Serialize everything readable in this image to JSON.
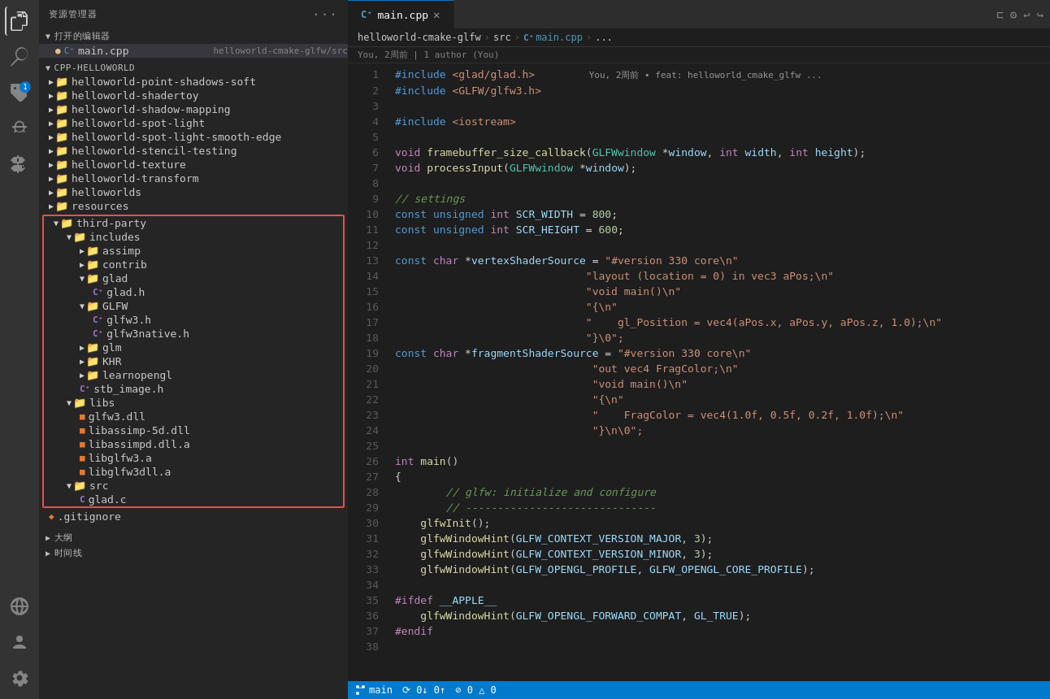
{
  "activityBar": {
    "icons": [
      {
        "name": "files-icon",
        "symbol": "⬡",
        "active": true
      },
      {
        "name": "search-icon",
        "symbol": "🔍",
        "active": false
      },
      {
        "name": "git-icon",
        "symbol": "⎇",
        "active": false
      },
      {
        "name": "debug-icon",
        "symbol": "▷",
        "active": false
      },
      {
        "name": "extensions-icon",
        "symbol": "⊞",
        "active": false
      },
      {
        "name": "remote-icon",
        "symbol": "◈",
        "active": false
      }
    ],
    "bottomIcons": [
      {
        "name": "accounts-icon",
        "symbol": "👤"
      },
      {
        "name": "settings-icon",
        "symbol": "⚙"
      }
    ],
    "notificationCount": "1"
  },
  "sidebar": {
    "header": "资源管理器",
    "openEditors": {
      "label": "打开的编辑器",
      "files": [
        {
          "name": "main.cpp",
          "path": "helloworld-cmake-glfw/src",
          "active": true,
          "modified": true,
          "icon": "cpp"
        }
      ]
    },
    "project": {
      "name": "CPP-HELLOWORLD",
      "items": [
        {
          "label": "helloworld-point-shadows-soft",
          "indent": 1,
          "type": "folder"
        },
        {
          "label": "helloworld-shadertoy",
          "indent": 1,
          "type": "folder"
        },
        {
          "label": "helloworld-shadow-mapping",
          "indent": 1,
          "type": "folder"
        },
        {
          "label": "helloworld-spot-light",
          "indent": 1,
          "type": "folder"
        },
        {
          "label": "helloworld-spot-light-smooth-edge",
          "indent": 1,
          "type": "folder"
        },
        {
          "label": "helloworld-stencil-testing",
          "indent": 1,
          "type": "folder"
        },
        {
          "label": "helloworld-texture",
          "indent": 1,
          "type": "folder"
        },
        {
          "label": "helloworld-transform",
          "indent": 1,
          "type": "folder"
        },
        {
          "label": "helloworlds",
          "indent": 1,
          "type": "folder"
        },
        {
          "label": "resources",
          "indent": 1,
          "type": "folder"
        },
        {
          "label": "third-party",
          "indent": 1,
          "type": "folder",
          "expanded": true,
          "highlighted": true
        },
        {
          "label": "includes",
          "indent": 2,
          "type": "folder",
          "expanded": true
        },
        {
          "label": "assimp",
          "indent": 3,
          "type": "folder"
        },
        {
          "label": "contrib",
          "indent": 3,
          "type": "folder"
        },
        {
          "label": "glad",
          "indent": 3,
          "type": "folder",
          "expanded": true
        },
        {
          "label": "glad.h",
          "indent": 4,
          "type": "h-file"
        },
        {
          "label": "GLFW",
          "indent": 3,
          "type": "folder",
          "expanded": true
        },
        {
          "label": "glfw3.h",
          "indent": 4,
          "type": "h-file"
        },
        {
          "label": "glfw3native.h",
          "indent": 4,
          "type": "h-file"
        },
        {
          "label": "glm",
          "indent": 3,
          "type": "folder"
        },
        {
          "label": "KHR",
          "indent": 3,
          "type": "folder"
        },
        {
          "label": "learnopengl",
          "indent": 3,
          "type": "folder"
        },
        {
          "label": "stb_image.h",
          "indent": 3,
          "type": "h-file"
        },
        {
          "label": "libs",
          "indent": 2,
          "type": "folder",
          "expanded": true
        },
        {
          "label": "glfw3.dll",
          "indent": 3,
          "type": "dll-file"
        },
        {
          "label": "libassimp-5d.dll",
          "indent": 3,
          "type": "dll-file"
        },
        {
          "label": "libassimpd.dll.a",
          "indent": 3,
          "type": "dll-file"
        },
        {
          "label": "libglfw3.a",
          "indent": 3,
          "type": "dll-file"
        },
        {
          "label": "libglfw3dll.a",
          "indent": 3,
          "type": "dll-file"
        },
        {
          "label": "src",
          "indent": 2,
          "type": "folder",
          "expanded": true
        },
        {
          "label": "glad.c",
          "indent": 3,
          "type": "c-file"
        },
        {
          "label": ".gitignore",
          "indent": 1,
          "type": "git-file"
        }
      ]
    }
  },
  "editor": {
    "tab": {
      "filename": "main.cpp",
      "modified": false,
      "icon": "cpp"
    },
    "breadcrumb": {
      "parts": [
        "helloworld-cmake-glfw",
        "src",
        "main.cpp",
        "..."
      ]
    },
    "gitBlame": "You, 2周前 | 1 author (You)",
    "gitInline": "You, 2周前 • feat: helloworld_cmake_glfw ...",
    "lines": [
      {
        "num": 1,
        "tokens": [
          {
            "t": "preprocessor",
            "v": "#include"
          },
          {
            "t": "space",
            "v": " "
          },
          {
            "t": "include-path",
            "v": "<glad/glad.h>"
          }
        ]
      },
      {
        "num": 2,
        "tokens": [
          {
            "t": "preprocessor",
            "v": "#include"
          },
          {
            "t": "space",
            "v": " "
          },
          {
            "t": "include-path",
            "v": "<GLFW/glfw3.h>"
          }
        ]
      },
      {
        "num": 3,
        "tokens": []
      },
      {
        "num": 4,
        "tokens": [
          {
            "t": "preprocessor",
            "v": "#include"
          },
          {
            "t": "space",
            "v": " "
          },
          {
            "t": "include-path",
            "v": "<iostream>"
          }
        ]
      },
      {
        "num": 5,
        "tokens": []
      },
      {
        "num": 6,
        "tokens": [
          {
            "t": "void",
            "v": "void"
          },
          {
            "t": "space",
            "v": " "
          },
          {
            "t": "fn",
            "v": "framebuffer_size_callback"
          },
          {
            "t": "plain",
            "v": "("
          },
          {
            "t": "type",
            "v": "GLFWwindow"
          },
          {
            "t": "space",
            "v": " "
          },
          {
            "t": "ptr",
            "v": "*"
          },
          {
            "t": "param",
            "v": "window"
          },
          {
            "t": "plain",
            "v": ", "
          },
          {
            "t": "int",
            "v": "int"
          },
          {
            "t": "space",
            "v": " "
          },
          {
            "t": "param",
            "v": "width"
          },
          {
            "t": "plain",
            "v": ", "
          },
          {
            "t": "int",
            "v": "int"
          },
          {
            "t": "space",
            "v": " "
          },
          {
            "t": "param",
            "v": "height"
          },
          {
            "t": "plain",
            "v": ");"
          }
        ]
      },
      {
        "num": 7,
        "tokens": [
          {
            "t": "void",
            "v": "void"
          },
          {
            "t": "space",
            "v": " "
          },
          {
            "t": "fn",
            "v": "processInput"
          },
          {
            "t": "plain",
            "v": "("
          },
          {
            "t": "type",
            "v": "GLFWwindow"
          },
          {
            "t": "space",
            "v": " "
          },
          {
            "t": "ptr",
            "v": "*"
          },
          {
            "t": "param",
            "v": "window"
          },
          {
            "t": "plain",
            "v": ");"
          }
        ]
      },
      {
        "num": 8,
        "tokens": []
      },
      {
        "num": 9,
        "tokens": [
          {
            "t": "comment",
            "v": "// settings"
          }
        ]
      },
      {
        "num": 10,
        "tokens": [
          {
            "t": "kw",
            "v": "const"
          },
          {
            "t": "space",
            "v": " "
          },
          {
            "t": "unsigned",
            "v": "unsigned"
          },
          {
            "t": "space",
            "v": " "
          },
          {
            "t": "int",
            "v": "int"
          },
          {
            "t": "space",
            "v": " "
          },
          {
            "t": "macro",
            "v": "SCR_WIDTH"
          },
          {
            "t": "plain",
            "v": " = "
          },
          {
            "t": "num",
            "v": "800"
          },
          {
            "t": "plain",
            "v": ";"
          }
        ]
      },
      {
        "num": 11,
        "tokens": [
          {
            "t": "kw",
            "v": "const"
          },
          {
            "t": "space",
            "v": " "
          },
          {
            "t": "unsigned",
            "v": "unsigned"
          },
          {
            "t": "space",
            "v": " "
          },
          {
            "t": "int",
            "v": "int"
          },
          {
            "t": "space",
            "v": " "
          },
          {
            "t": "macro",
            "v": "SCR_HEIGHT"
          },
          {
            "t": "plain",
            "v": " = "
          },
          {
            "t": "num",
            "v": "600"
          },
          {
            "t": "plain",
            "v": ";"
          }
        ]
      },
      {
        "num": 12,
        "tokens": []
      },
      {
        "num": 13,
        "tokens": [
          {
            "t": "kw",
            "v": "const"
          },
          {
            "t": "space",
            "v": " "
          },
          {
            "t": "char",
            "v": "char"
          },
          {
            "t": "space",
            "v": " "
          },
          {
            "t": "ptr",
            "v": "*"
          },
          {
            "t": "macro",
            "v": "vertexShaderSource"
          },
          {
            "t": "plain",
            "v": " = "
          },
          {
            "t": "str",
            "v": "\"#version 330 core\\n\""
          }
        ]
      },
      {
        "num": 14,
        "tokens": [
          {
            "t": "str",
            "v": "                              \"layout (location = 0) in vec3 aPos;\\n\""
          }
        ]
      },
      {
        "num": 15,
        "tokens": [
          {
            "t": "str",
            "v": "                              \"void main()\\n\""
          }
        ]
      },
      {
        "num": 16,
        "tokens": [
          {
            "t": "str",
            "v": "                              \"{\\n\""
          }
        ]
      },
      {
        "num": 17,
        "tokens": [
          {
            "t": "str",
            "v": "                              \"    gl_Position = vec4(aPos.x, aPos.y, aPos.z, 1.0);\\n\""
          }
        ]
      },
      {
        "num": 18,
        "tokens": [
          {
            "t": "str",
            "v": "                              \"}\\0\";"
          }
        ]
      },
      {
        "num": 19,
        "tokens": [
          {
            "t": "kw",
            "v": "const"
          },
          {
            "t": "space",
            "v": " "
          },
          {
            "t": "char",
            "v": "char"
          },
          {
            "t": "space",
            "v": " "
          },
          {
            "t": "ptr",
            "v": "*"
          },
          {
            "t": "macro",
            "v": "fragmentShaderSource"
          },
          {
            "t": "plain",
            "v": " = "
          },
          {
            "t": "str",
            "v": "\"#version 330 core\\n\""
          }
        ]
      },
      {
        "num": 20,
        "tokens": [
          {
            "t": "str",
            "v": "                               \"out vec4 FragColor;\\n\""
          }
        ]
      },
      {
        "num": 21,
        "tokens": [
          {
            "t": "str",
            "v": "                               \"void main()\\n\""
          }
        ]
      },
      {
        "num": 22,
        "tokens": [
          {
            "t": "str",
            "v": "                               \"{\\n\""
          }
        ]
      },
      {
        "num": 23,
        "tokens": [
          {
            "t": "str",
            "v": "                               \"    FragColor = vec4(1.0f, 0.5f, 0.2f, 1.0f);\\n\""
          }
        ]
      },
      {
        "num": 24,
        "tokens": [
          {
            "t": "str",
            "v": "                               \"}\\n\\0\";"
          }
        ]
      },
      {
        "num": 25,
        "tokens": []
      },
      {
        "num": 26,
        "tokens": [
          {
            "t": "int",
            "v": "int"
          },
          {
            "t": "space",
            "v": " "
          },
          {
            "t": "fn",
            "v": "main"
          },
          {
            "t": "plain",
            "v": "()"
          }
        ]
      },
      {
        "num": 27,
        "tokens": [
          {
            "t": "plain",
            "v": "{"
          }
        ]
      },
      {
        "num": 28,
        "tokens": [
          {
            "t": "comment",
            "v": "        // glfw: initialize and configure"
          }
        ]
      },
      {
        "num": 29,
        "tokens": [
          {
            "t": "comment",
            "v": "        // ------------------------------"
          }
        ]
      },
      {
        "num": 30,
        "tokens": [
          {
            "t": "space",
            "v": "    "
          },
          {
            "t": "fn",
            "v": "glfwInit"
          },
          {
            "t": "plain",
            "v": "();"
          }
        ]
      },
      {
        "num": 31,
        "tokens": [
          {
            "t": "space",
            "v": "    "
          },
          {
            "t": "fn",
            "v": "glfwWindowHint"
          },
          {
            "t": "plain",
            "v": "("
          },
          {
            "t": "macro",
            "v": "GLFW_CONTEXT_VERSION_MAJOR"
          },
          {
            "t": "plain",
            "v": ", "
          },
          {
            "t": "num",
            "v": "3"
          },
          {
            "t": "plain",
            "v": ");"
          }
        ]
      },
      {
        "num": 32,
        "tokens": [
          {
            "t": "space",
            "v": "    "
          },
          {
            "t": "fn",
            "v": "glfwWindowHint"
          },
          {
            "t": "plain",
            "v": "("
          },
          {
            "t": "macro",
            "v": "GLFW_CONTEXT_VERSION_MINOR"
          },
          {
            "t": "plain",
            "v": ", "
          },
          {
            "t": "num",
            "v": "3"
          },
          {
            "t": "plain",
            "v": ");"
          }
        ]
      },
      {
        "num": 33,
        "tokens": [
          {
            "t": "space",
            "v": "    "
          },
          {
            "t": "fn",
            "v": "glfwWindowHint"
          },
          {
            "t": "plain",
            "v": "("
          },
          {
            "t": "macro",
            "v": "GLFW_OPENGL_PROFILE"
          },
          {
            "t": "plain",
            "v": ", "
          },
          {
            "t": "macro",
            "v": "GLFW_OPENGL_CORE_PROFILE"
          },
          {
            "t": "plain",
            "v": ");"
          }
        ]
      },
      {
        "num": 34,
        "tokens": []
      },
      {
        "num": 35,
        "tokens": [
          {
            "t": "ifdef",
            "v": "#ifdef"
          },
          {
            "t": "space",
            "v": " "
          },
          {
            "t": "ifdef-macro",
            "v": "__APPLE__"
          }
        ]
      },
      {
        "num": 36,
        "tokens": [
          {
            "t": "space",
            "v": "    "
          },
          {
            "t": "fn",
            "v": "glfwWindowHint"
          },
          {
            "t": "plain",
            "v": "("
          },
          {
            "t": "macro",
            "v": "GLFW_OPENGL_FORWARD_COMPAT"
          },
          {
            "t": "plain",
            "v": ", "
          },
          {
            "t": "macro",
            "v": "GL_TRUE"
          },
          {
            "t": "plain",
            "v": ");"
          }
        ]
      },
      {
        "num": 37,
        "tokens": [
          {
            "t": "ifdef",
            "v": "#endif"
          }
        ]
      },
      {
        "num": 38,
        "tokens": []
      }
    ]
  },
  "bottomTabs": {
    "items": [
      "大纲",
      "时间线"
    ]
  },
  "statusBar": {
    "branch": "main",
    "errors": "0",
    "warnings": "0"
  }
}
